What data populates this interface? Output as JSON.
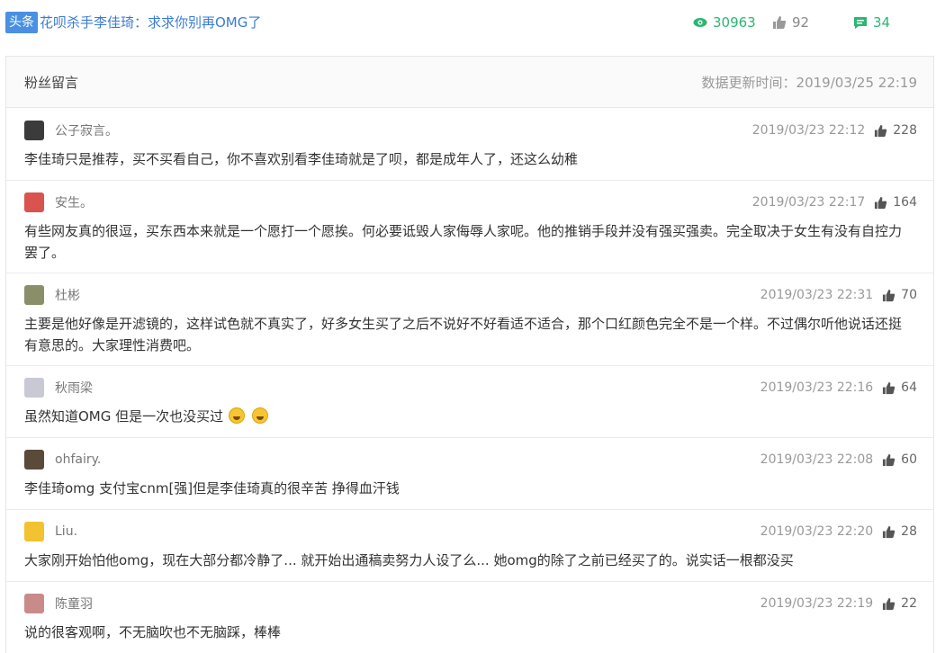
{
  "header": {
    "tag": "头条",
    "headline": "花呗杀手李佳琦：求求你别再OMG了",
    "views": "30963",
    "likes": "92",
    "comments": "34"
  },
  "panel": {
    "title": "粉丝留言",
    "updated": "数据更新时间：2019/03/25 22:19"
  },
  "comments": [
    {
      "user": "公子寂言。",
      "time": "2019/03/23 22:12",
      "likes": "228",
      "avatar_color": "#3b3b3b",
      "text": "李佳琦只是推荐，买不买看自己，你不喜欢别看李佳琦就是了呗，都是成年人了，还这么幼稚"
    },
    {
      "user": "安生。",
      "time": "2019/03/23 22:17",
      "likes": "164",
      "avatar_color": "#d9534f",
      "text": "有些网友真的很逗，买东西本来就是一个愿打一个愿挨。何必要诋毁人家侮辱人家呢。他的推销手段并没有强买强卖。完全取决于女生有没有自控力罢了。"
    },
    {
      "user": "杜彬",
      "time": "2019/03/23 22:31",
      "likes": "70",
      "avatar_color": "#8a8f6a",
      "text": "主要是他好像是开滤镜的，这样试色就不真实了，好多女生买了之后不说好不好看适不适合，那个口红颜色完全不是一个样。不过偶尔听他说话还挺有意思的。大家理性消费吧。"
    },
    {
      "user": "秋雨梁",
      "time": "2019/03/23 22:16",
      "likes": "64",
      "avatar_color": "#c9c9d6",
      "text": "虽然知道OMG 但是一次也没买过"
    },
    {
      "user": "ohfairy.",
      "time": "2019/03/23 22:08",
      "likes": "60",
      "avatar_color": "#5a4a3a",
      "text": "李佳琦omg 支付宝cnm[强]但是李佳琦真的很辛苦 挣得血汗钱"
    },
    {
      "user": "Liu.",
      "time": "2019/03/23 22:20",
      "likes": "28",
      "avatar_color": "#f2c230",
      "text": "大家刚开始怕他omg，现在大部分都冷静了... 就开始出通稿卖努力人设了么... 她omg的除了之前已经买了的。说实话一根都没买"
    },
    {
      "user": "陈童羽",
      "time": "2019/03/23 22:19",
      "likes": "22",
      "avatar_color": "#c98a8a",
      "text": "说的很客观啊，不无脑吹也不无脑踩，棒棒"
    }
  ]
}
